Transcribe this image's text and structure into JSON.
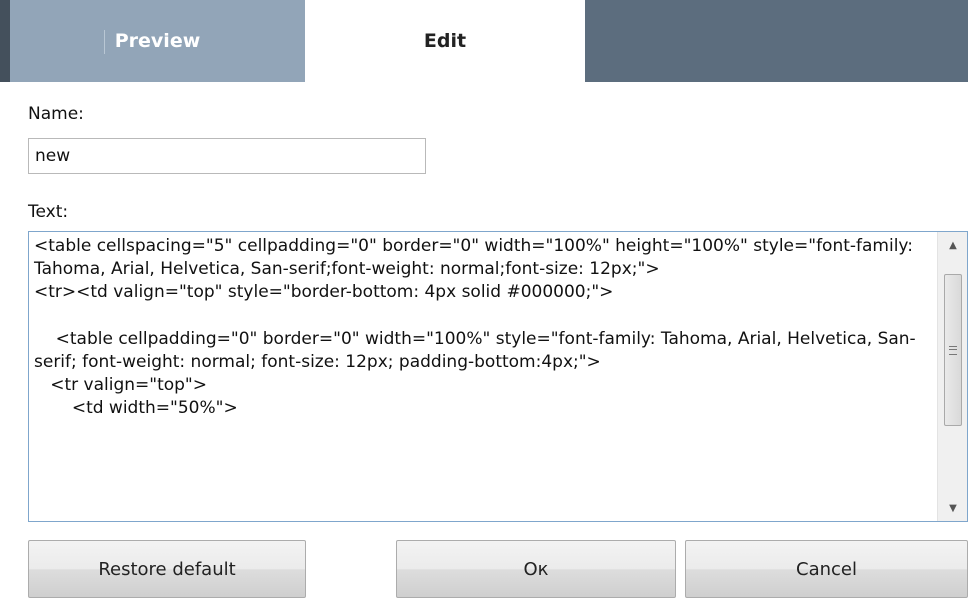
{
  "tabs": {
    "preview_label": "Preview",
    "edit_label": "Edit"
  },
  "form": {
    "name_label": "Name:",
    "name_value": "new",
    "text_label": "Text:",
    "text_value": "<table cellspacing=\"5\" cellpadding=\"0\" border=\"0\" width=\"100%\" height=\"100%\" style=\"font-family: Tahoma, Arial, Helvetica, San-serif;font-weight: normal;font-size: 12px;\">\n<tr><td valign=\"top\" style=\"border-bottom: 4px solid #000000;\">\n\n    <table cellpadding=\"0\" border=\"0\" width=\"100%\" style=\"font-family: Tahoma, Arial, Helvetica, San-serif; font-weight: normal; font-size: 12px; padding-bottom:4px;\">\n   <tr valign=\"top\">\n       <td width=\"50%\">"
  },
  "buttons": {
    "restore_label": "Restore default",
    "ok_label": "Ок",
    "cancel_label": "Cancel"
  },
  "icons": {
    "scroll_up": "scroll-up-arrow-icon",
    "scroll_down": "scroll-down-arrow-icon",
    "scroll_grip": "scroll-grip-icon"
  },
  "colors": {
    "tab_bar": "#5c6d7e",
    "tab_preview_bg": "#92a5b8",
    "tab_edit_bg": "#ffffff",
    "text_box_border": "#7fa6cc"
  }
}
